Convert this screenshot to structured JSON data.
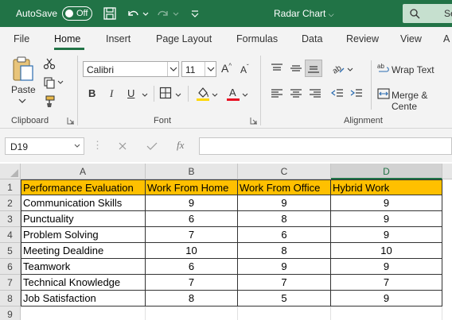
{
  "titlebar": {
    "autosave_label": "AutoSave",
    "autosave_state": "Off",
    "doc_title": "Radar Chart",
    "search_placeholder": "Se"
  },
  "tabs": [
    {
      "label": "File"
    },
    {
      "label": "Home"
    },
    {
      "label": "Insert"
    },
    {
      "label": "Page Layout"
    },
    {
      "label": "Formulas"
    },
    {
      "label": "Data"
    },
    {
      "label": "Review"
    },
    {
      "label": "View"
    },
    {
      "label": "A"
    }
  ],
  "ribbon": {
    "clipboard": {
      "paste_label": "Paste",
      "group_label": "Clipboard"
    },
    "font": {
      "font_name": "Calibri",
      "font_size": "11",
      "bold": "B",
      "italic": "I",
      "underline": "U",
      "grow": "A",
      "shrink": "A",
      "group_label": "Font",
      "highlight_color": "#ffd700",
      "font_color": "#e81123"
    },
    "alignment": {
      "wrap_text": "Wrap Text",
      "merge_center": "Merge & Cente",
      "group_label": "Alignment"
    }
  },
  "formula_bar": {
    "name_box": "D19",
    "fx_label": "fx",
    "formula": ""
  },
  "sheet": {
    "columns": [
      "A",
      "B",
      "C",
      "D"
    ],
    "rows": [
      "1",
      "2",
      "3",
      "4",
      "5",
      "6",
      "7",
      "8",
      "9"
    ],
    "header_row": [
      "Performance Evaluation",
      "Work From Home",
      "Work From Office",
      "Hybrid Work"
    ],
    "data_rows": [
      [
        "Communication Skills",
        "9",
        "9",
        "9"
      ],
      [
        "Punctuality",
        "6",
        "8",
        "9"
      ],
      [
        "Problem Solving",
        "7",
        "6",
        "9"
      ],
      [
        "Meeting Dealdine",
        "10",
        "8",
        "10"
      ],
      [
        "Teamwork",
        "6",
        "9",
        "9"
      ],
      [
        "Technical Knowledge",
        "7",
        "7",
        "7"
      ],
      [
        "Job Satisfaction",
        "8",
        "5",
        "9"
      ]
    ],
    "header_fill": "#ffc000",
    "selected_column": "D"
  },
  "colors": {
    "accent": "#217346"
  }
}
